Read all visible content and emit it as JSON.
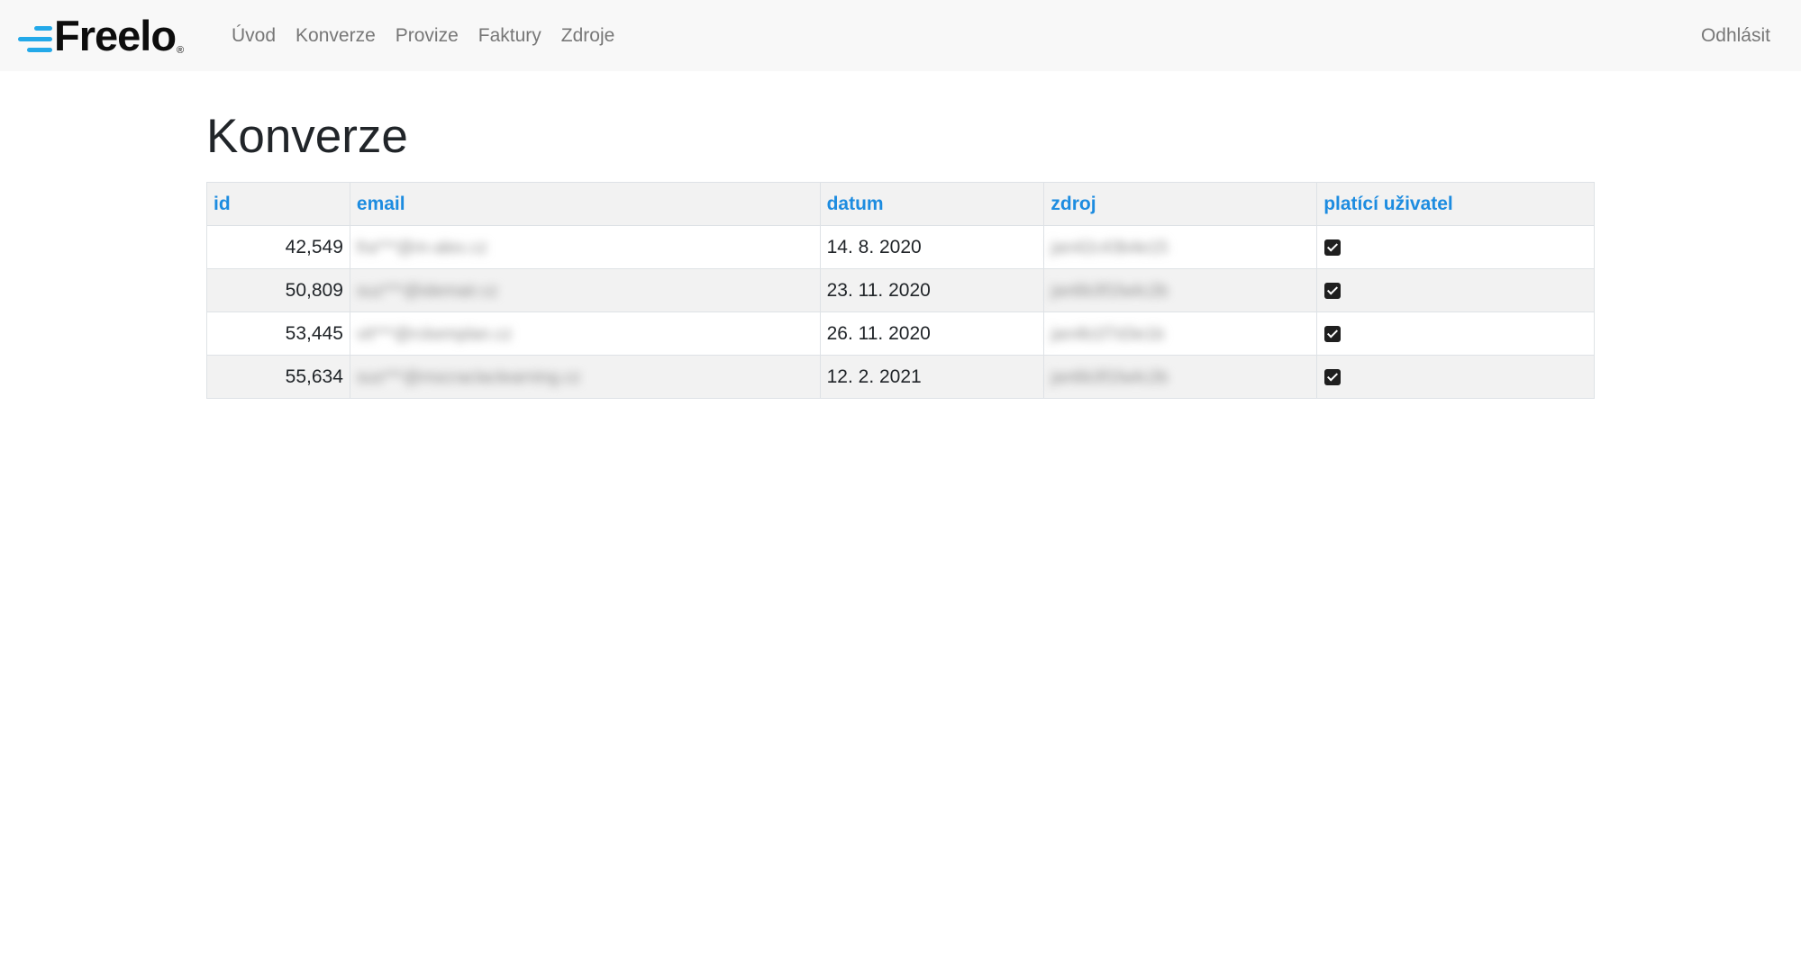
{
  "brand": {
    "name": "Freelo",
    "registered": "®",
    "accent_color": "#23a9e9"
  },
  "nav": {
    "items": [
      {
        "label": "Úvod"
      },
      {
        "label": "Konverze"
      },
      {
        "label": "Provize"
      },
      {
        "label": "Faktury"
      },
      {
        "label": "Zdroje"
      }
    ],
    "logout_label": "Odhlásit"
  },
  "page": {
    "title": "Konverze"
  },
  "table": {
    "header_color": "#1d8ce0",
    "columns": [
      {
        "label": "id"
      },
      {
        "label": "email"
      },
      {
        "label": "datum"
      },
      {
        "label": "zdroj"
      },
      {
        "label": "platící uživatel"
      }
    ],
    "rows": [
      {
        "id": "42,549",
        "email": "fra***@m-alex.cz",
        "datum": "14. 8. 2020",
        "zdroj": "jan42c43b4e15",
        "paid": true
      },
      {
        "id": "50,809",
        "email": "suz***@idemair.cz",
        "datum": "23. 11. 2020",
        "zdroj": "jan6b3f1fa4c2b",
        "paid": true
      },
      {
        "id": "53,445",
        "email": "vit***@rckemplan.cz",
        "datum": "26. 11. 2020",
        "zdroj": "jan4b1f7d3e1b",
        "paid": true
      },
      {
        "id": "55,634",
        "email": "sus***@mscraclaclearning.cz",
        "datum": "12. 2. 2021",
        "zdroj": "jan6b3f1fa4c2b",
        "paid": true
      }
    ]
  }
}
